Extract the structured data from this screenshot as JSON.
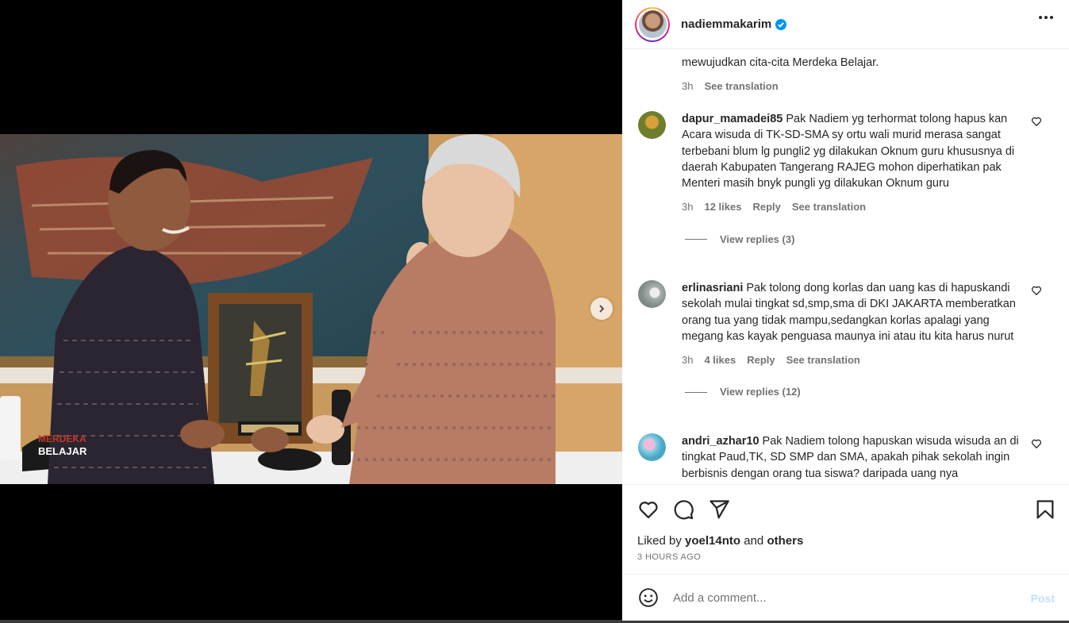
{
  "post": {
    "username": "nadiemmakarim",
    "verified": true,
    "more_icon": "more-horizontal-icon"
  },
  "caption": {
    "tail_text": "mewujudkan cita-cita Merdeka Belajar.",
    "time": "3h",
    "see_translation": "See translation"
  },
  "comments": [
    {
      "username": "dapur_mamadei85",
      "text": "Pak Nadiem yg terhormat tolong hapus kan Acara wisuda di TK-SD-SMA sy ortu wali murid merasa sangat terbebani blum lg pungli2 yg dilakukan Oknum guru khususnya di daerah Kabupaten Tangerang RAJEG mohon diperhatikan pak Menteri masih bnyk pungli yg dilakukan Oknum guru",
      "time": "3h",
      "likes": "12 likes",
      "reply": "Reply",
      "see_translation": "See translation",
      "view_replies": "View replies (3)",
      "avatar_color": "#7a8a3a"
    },
    {
      "username": "erlinasriani",
      "text": "Pak tolong dong korlas dan uang kas di hapuskandi sekolah mulai tingkat sd,smp,sma di DKI JAKARTA memberatkan orang tua yang tidak mampu,sedangkan korlas apalagi yang megang kas kayak penguasa maunya ini atau itu kita harus nurut",
      "time": "3h",
      "likes": "4 likes",
      "reply": "Reply",
      "see_translation": "See translation",
      "view_replies": "View replies (12)",
      "avatar_color": "#9aa3a0"
    },
    {
      "username": "andri_azhar10",
      "text": "Pak Nadiem tolong hapuskan wisuda wisuda an di tingkat Paud,TK, SD SMP dan SMA, apakah pihak sekolah ingin berbisnis dengan orang tua siswa? daripada uang nya",
      "avatar_color": "#6fc6d9"
    }
  ],
  "actions": {
    "like_icon": "heart-icon",
    "comment_icon": "comment-icon",
    "share_icon": "share-icon",
    "save_icon": "bookmark-icon"
  },
  "likes": {
    "prefix": "Liked by",
    "user": "yoel14nto",
    "middle": "and",
    "others": "others"
  },
  "time_ago": "3 HOURS AGO",
  "add_comment": {
    "placeholder": "Add a comment...",
    "post_label": "Post",
    "emoji_icon": "emoji-icon"
  },
  "media": {
    "carousel_dots": 4,
    "active_dot": 1,
    "next_icon": "chevron-right-icon",
    "cap_text_1": "MERDEKA",
    "cap_text_2": "BELAJAR"
  }
}
